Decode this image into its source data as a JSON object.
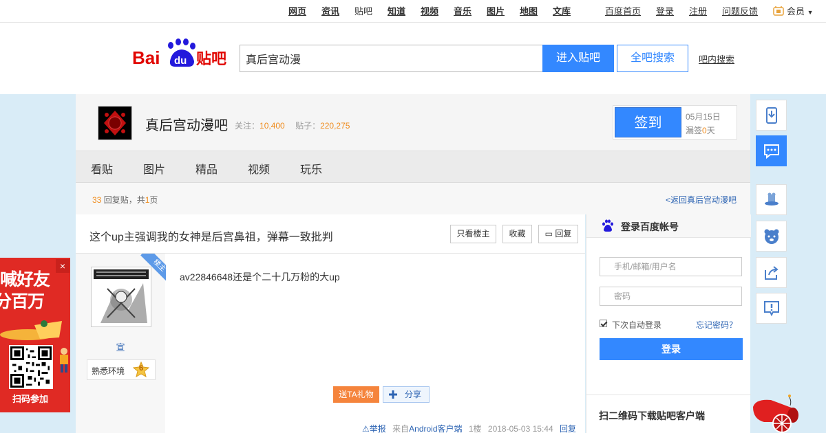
{
  "topnav": {
    "links": [
      "网页",
      "资讯",
      "贴吧",
      "知道",
      "视频",
      "音乐",
      "图片",
      "地图",
      "文库"
    ],
    "right": [
      "百度首页",
      "登录",
      "注册",
      "问题反馈"
    ],
    "member": "会员"
  },
  "header": {
    "logo_text": "Baidu贴吧",
    "search_value": "真后宫动漫",
    "enter_button": "进入贴吧",
    "all_search_button": "全吧搜索",
    "inner_search": "吧内搜索"
  },
  "forum": {
    "name": "真后宫动漫吧",
    "follow_label": "关注：",
    "follow_count": "10,400",
    "posts_label": "贴子：",
    "posts_count": "220,275",
    "sign_button": "签到",
    "sign_date": "05月15日",
    "missed_label": "漏签",
    "missed_days": "0",
    "missed_unit": "天"
  },
  "tabs": [
    "看贴",
    "图片",
    "精品",
    "视频",
    "玩乐"
  ],
  "thread": {
    "reply_count": "33",
    "reply_label": "回复贴，共",
    "pages": "1",
    "pages_unit": "页",
    "back_link": "<返回真后宫动漫吧",
    "title": "这个up主强调我的女神是后宫鼻祖，弹幕一致批判",
    "buttons": {
      "only_host": "只看楼主",
      "favorite": "收藏",
      "reply": "回复"
    }
  },
  "post": {
    "author": "宣",
    "level_name": "熟悉环境",
    "level": "6",
    "host_badge": "楼主",
    "content": "av22846648还是个二十几万粉的大up",
    "gift_button": "送TA礼物",
    "share_button": "分享",
    "report": "举报",
    "source_prefix": "来自",
    "source": "Android客户端",
    "floor": "1楼",
    "time": "2018-05-03 15:44",
    "reply": "回复"
  },
  "login": {
    "title": "登录百度帐号",
    "username_placeholder": "手机/邮箱/用户名",
    "password_placeholder": "密码",
    "remember": "下次自动登录",
    "forgot": "忘记密码？",
    "submit": "登录",
    "qr_title": "扫二维码下载贴吧客户端"
  },
  "ad": {
    "line1": "喊好友",
    "line2": "分百万",
    "cta": "扫码参加",
    "close": "×"
  },
  "colors": {
    "accent": "#3388ff",
    "link": "#2d64b3",
    "orange": "#f08c1e",
    "ad_red": "#e02a24"
  }
}
